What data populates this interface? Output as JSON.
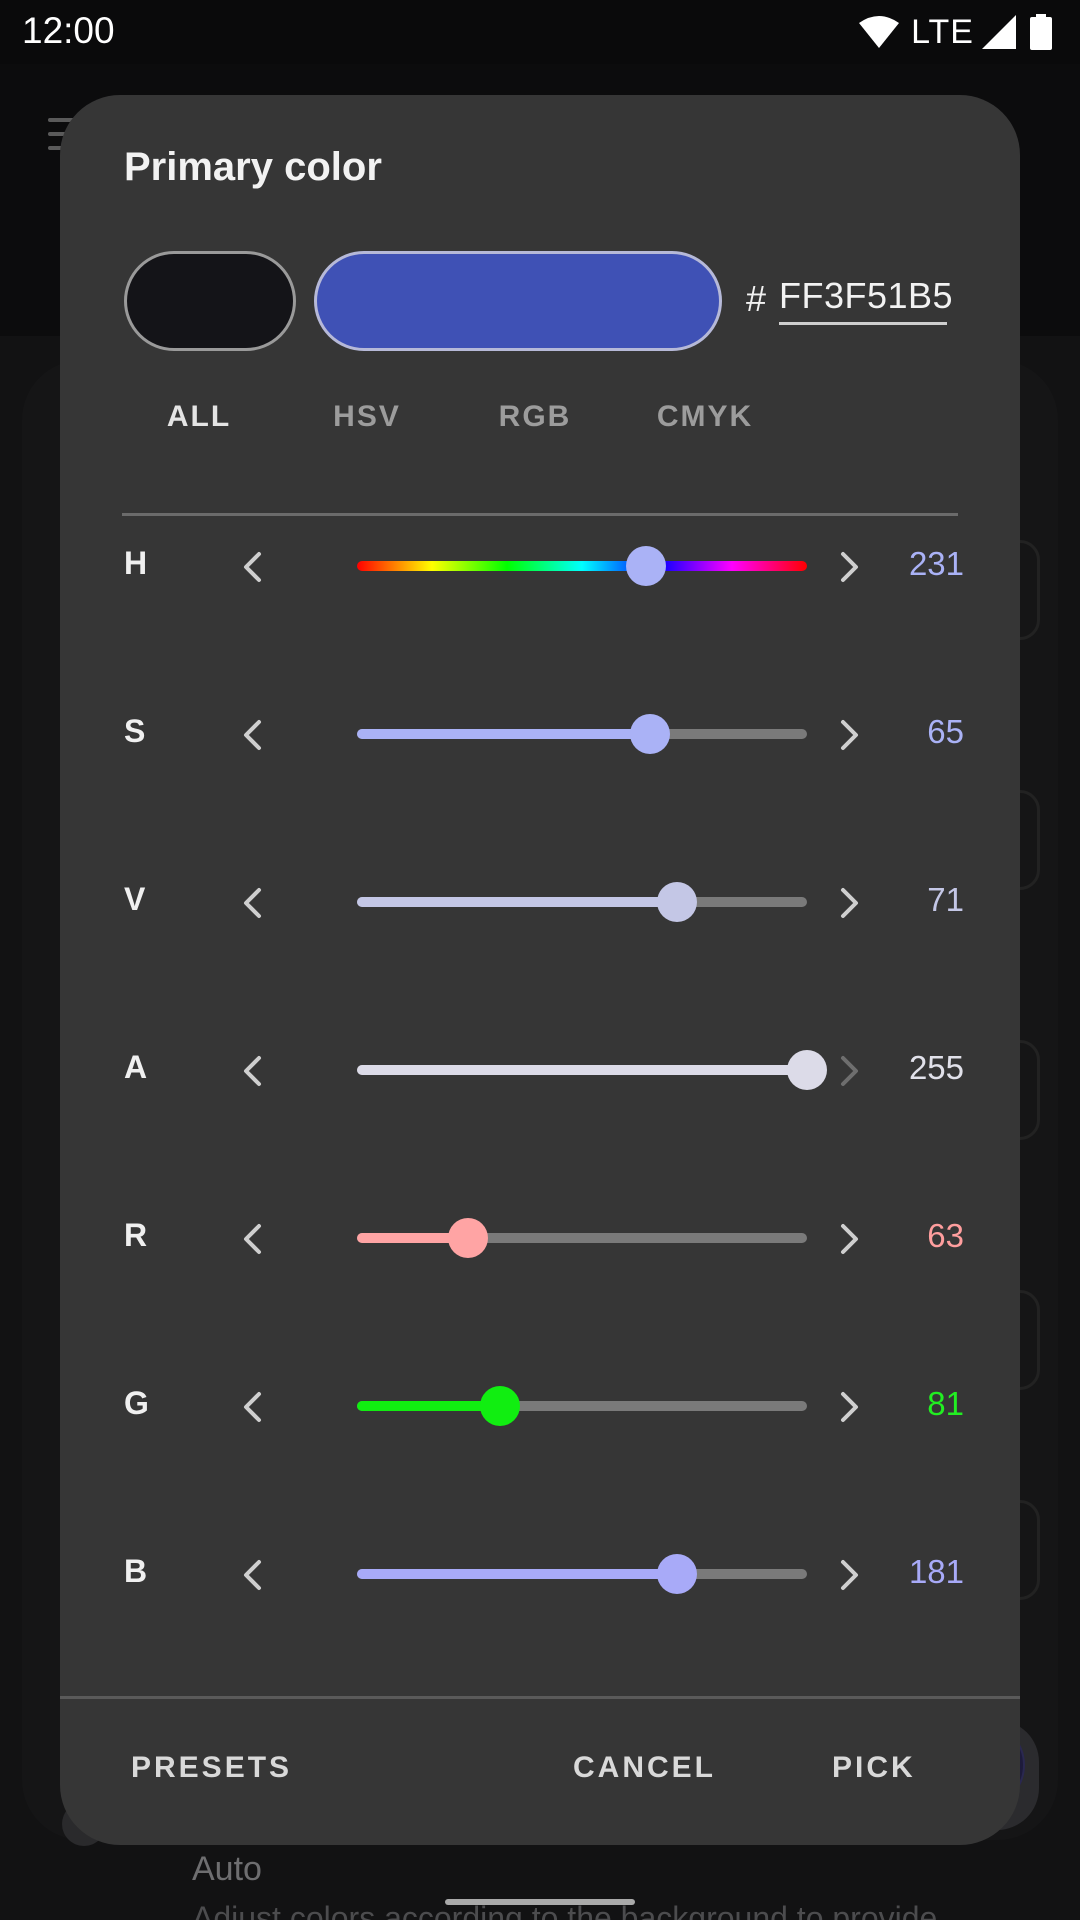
{
  "status_bar": {
    "time": "12:00",
    "network": "LTE",
    "icons": [
      "wifi-icon",
      "signal-icon",
      "battery-icon"
    ]
  },
  "background": {
    "auto_label": "Auto",
    "description": "Adjust colors according to the background to provide"
  },
  "dialog": {
    "title": "Primary color",
    "old_color": "#141418",
    "new_color": "#3F51B5",
    "hash_symbol": "#",
    "hex_value": "FF3F51B5",
    "tabs": [
      {
        "label": "ALL",
        "active": true
      },
      {
        "label": "HSV",
        "active": false
      },
      {
        "label": "RGB",
        "active": false
      },
      {
        "label": "CMYK",
        "active": false
      }
    ],
    "sliders": [
      {
        "label": "H",
        "value": "231",
        "fraction": 0.642,
        "value_color": "#aab2f6",
        "kind": "hue",
        "thumb_color": "#aab2f6",
        "right_enabled": true
      },
      {
        "label": "S",
        "value": "65",
        "fraction": 0.65,
        "value_color": "#aab2f6",
        "kind": "fill",
        "fill_color": "#aab2f6",
        "thumb_color": "#aab2f6",
        "right_enabled": true
      },
      {
        "label": "V",
        "value": "71",
        "fraction": 0.71,
        "value_color": "#c4c7e6",
        "kind": "fill",
        "fill_color": "#c4c7e6",
        "thumb_color": "#c4c7e6",
        "right_enabled": true
      },
      {
        "label": "A",
        "value": "255",
        "fraction": 1.0,
        "value_color": "#e1e1ea",
        "kind": "fill",
        "fill_color": "#dcdbe8",
        "thumb_color": "#dcdbe8",
        "right_enabled": false
      },
      {
        "label": "R",
        "value": "63",
        "fraction": 0.247,
        "value_color": "#ff9e9e",
        "kind": "fill",
        "fill_color": "#ffa4a4",
        "thumb_color": "#ffa4a4",
        "right_enabled": true
      },
      {
        "label": "G",
        "value": "81",
        "fraction": 0.318,
        "value_color": "#22ee22",
        "kind": "fill",
        "fill_color": "#11ee11",
        "thumb_color": "#11ee11",
        "right_enabled": true
      },
      {
        "label": "B",
        "value": "181",
        "fraction": 0.71,
        "value_color": "#a8aaf8",
        "kind": "fill",
        "fill_color": "#a8aaf8",
        "thumb_color": "#a8aaf8",
        "right_enabled": true
      }
    ],
    "footer": {
      "presets_label": "PRESETS",
      "cancel_label": "CANCEL",
      "pick_label": "PICK"
    }
  }
}
